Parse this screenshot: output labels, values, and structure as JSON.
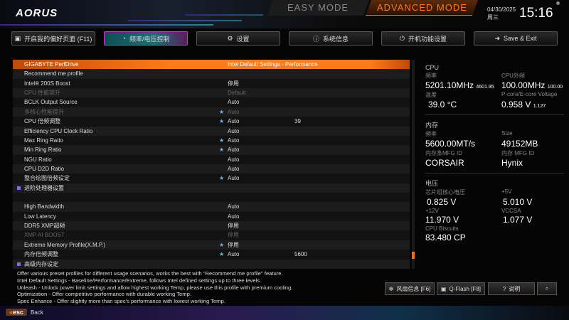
{
  "header": {
    "logo": "AORUS",
    "easy_mode": "EASY MODE",
    "advanced_mode": "ADVANCED MODE",
    "date": "04/30/2025",
    "weekday": "周三",
    "time": "15:16"
  },
  "tabs": [
    {
      "label": "开启我的偏好页面 (F11)",
      "icon": "favorite-icon"
    },
    {
      "label": "频率/电压控制",
      "icon": "gauge-icon",
      "active": true
    },
    {
      "label": "设置",
      "icon": "gear-icon"
    },
    {
      "label": "系统信息",
      "icon": "info-icon"
    },
    {
      "label": "开机功能设置",
      "icon": "power-icon"
    },
    {
      "label": "Save & Exit",
      "icon": "exit-icon"
    }
  ],
  "settings": [
    {
      "name": "GIGABYTE PerfDrive",
      "value": "Intel Default Settings - Performance"
    },
    {
      "name": "Recommend me profile",
      "value": ""
    },
    {
      "name": "Intel® 200S Boost",
      "value": "停用"
    },
    {
      "name": "CPU 性能提升",
      "value": "Default",
      "disabled": true
    },
    {
      "name": "BCLK Output Source",
      "value": "Auto"
    },
    {
      "name": "多核心性能提升",
      "value": "Auto",
      "star": true,
      "disabled": true
    },
    {
      "name": "CPU 倍频调整",
      "value": "Auto",
      "star": true,
      "extra": "39"
    },
    {
      "name": "Efficiency CPU Clock Ratio",
      "value": "Auto"
    },
    {
      "name": "Max Ring Ratio",
      "value": "Auto",
      "star": true
    },
    {
      "name": "Min Ring Ratio",
      "value": "Auto",
      "star": true
    },
    {
      "name": "NGU Ratio",
      "value": "Auto"
    },
    {
      "name": "CPU D2D Ratio",
      "value": "Auto"
    },
    {
      "name": "整合绘图倍频设定",
      "value": "Auto",
      "star": true
    },
    {
      "name": "进阶处理器设置",
      "value": "",
      "submenu": true
    },
    {
      "name": "",
      "value": ""
    },
    {
      "name": "High Bandwidth",
      "value": "Auto"
    },
    {
      "name": "Low Latency",
      "value": "Auto"
    },
    {
      "name": "DDR5 XMP超频",
      "value": "停用"
    },
    {
      "name": "XMP AI BOOST",
      "value": "停用",
      "disabled": true
    },
    {
      "name": "Extreme Memory Profile(X.M.P.)",
      "value": "停用",
      "star": true
    },
    {
      "name": "内存倍频调整",
      "value": "Auto",
      "star": true,
      "extra": "5600"
    },
    {
      "name": "高级内存设定",
      "value": "",
      "submenu": true
    }
  ],
  "scroll_position": 0.95,
  "info": {
    "cpu": {
      "title": "CPU",
      "freq_label": "频率",
      "freq": "5201.10MHz",
      "freq_sub": "4601.95",
      "bclk_label": "CPU外频",
      "bclk": "100.00MHz",
      "bclk_sub": "100.00",
      "temp_label": "温度",
      "temp": "39.0 °C",
      "volt_label": "P-core/E-core Voltage",
      "volt": "0.958 V",
      "volt_sub": "1.127"
    },
    "memory": {
      "title": "内存",
      "freq_label": "频率",
      "freq": "5600.00MT/s",
      "size_label": "Size",
      "size": "49152MB",
      "mfg_label": "内存条MFG ID",
      "mfg": "CORSAIR",
      "chip_label": "内存 MFG ID",
      "chip": "Hynix"
    },
    "voltage": {
      "title": "电压",
      "chipset_label": "芯片组核心电压",
      "chipset": "0.825 V",
      "v5_label": "+5V",
      "v5": "5.010 V",
      "v12_label": "+12V",
      "v12": "11.970 V",
      "vccsa_label": "VCCSA",
      "vccsa": "1.077 V",
      "biscuits_label": "CPU Biscuits",
      "biscuits": "83.480 CP"
    }
  },
  "help": [
    "Offer various preset profiles for different usage scenarios, works the best with \"Recommend me profile\" feature.",
    "Intel Default Settings - Baseline/Performance/Extreme, follows Intel defined settings up to three levels.",
    "Unleash - Unlock power limit settings and allow highest working Temp, please use this profile with premium cooling.",
    "Optimization - Offer competitive performance with durable working Temp.",
    "Spec Enhance - Offer slightly more than spec's performance with lowest working Temp."
  ],
  "bottom_buttons": {
    "fan": "风扇信息 [F6]",
    "qflash": "Q-Flash [F8]",
    "help": "说明"
  },
  "footer": {
    "esc": "esc",
    "back": "Back"
  }
}
